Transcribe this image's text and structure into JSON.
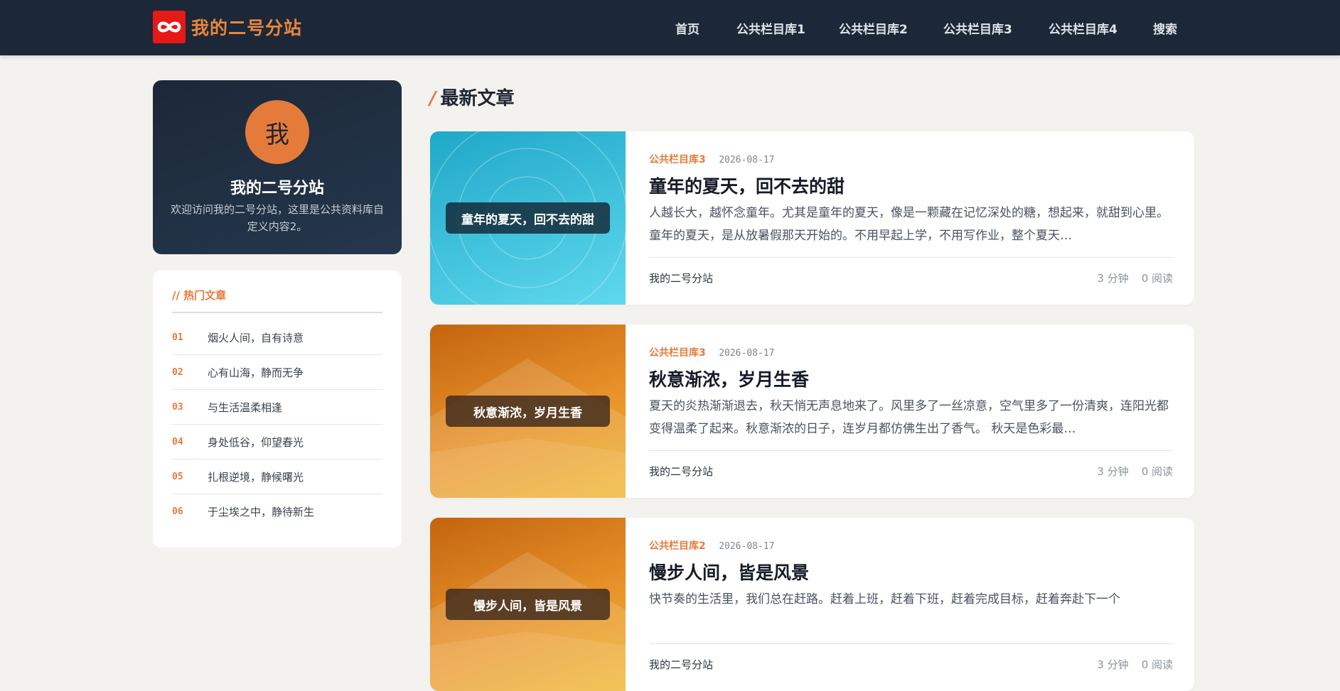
{
  "header": {
    "site_name": "我的二号分站",
    "logo_icon": "infinity-icon",
    "nav": [
      {
        "label": "首页"
      },
      {
        "label": "公共栏目库1"
      },
      {
        "label": "公共栏目库2"
      },
      {
        "label": "公共栏目库3"
      },
      {
        "label": "公共栏目库4"
      },
      {
        "label": "搜索"
      }
    ]
  },
  "profile": {
    "avatar_char": "我",
    "name": "我的二号分站",
    "desc": "欢迎访问我的二号分站，这里是公共资料库自定义内容2。"
  },
  "hot": {
    "title": "// 热门文章",
    "items": [
      {
        "num": "01",
        "text": "烟火人间，自有诗意"
      },
      {
        "num": "02",
        "text": "心有山海，静而无争"
      },
      {
        "num": "03",
        "text": "与生活温柔相逢"
      },
      {
        "num": "04",
        "text": "身处低谷，仰望春光"
      },
      {
        "num": "05",
        "text": "扎根逆境，静候曙光"
      },
      {
        "num": "06",
        "text": "于尘埃之中，静待新生"
      }
    ]
  },
  "main": {
    "section_title": "最新文章",
    "section_slash": "/",
    "articles": [
      {
        "thumb_label": "童年的夏天，回不去的甜",
        "category": "公共栏目库3",
        "date": "2026-08-17",
        "title": "童年的夏天，回不去的甜",
        "excerpt": "人越长大，越怀念童年。尤其是童年的夏天，像是一颗藏在记忆深处的糖，想起来，就甜到心里。 童年的夏天，是从放暑假那天开始的。不用早起上学，不用写作业，整个夏天…",
        "author": "我的二号分站",
        "read_time": "3 分钟",
        "views": "0 阅读"
      },
      {
        "thumb_label": "秋意渐浓，岁月生香",
        "category": "公共栏目库3",
        "date": "2026-08-17",
        "title": "秋意渐浓，岁月生香",
        "excerpt": "夏天的炎热渐渐退去，秋天悄无声息地来了。风里多了一丝凉意，空气里多了一份清爽，连阳光都变得温柔了起来。秋意渐浓的日子，连岁月都仿佛生出了香气。 秋天是色彩最…",
        "author": "我的二号分站",
        "read_time": "3 分钟",
        "views": "0 阅读"
      },
      {
        "thumb_label": "慢步人间，皆是风景",
        "category": "公共栏目库2",
        "date": "2026-08-17",
        "title": "慢步人间，皆是风景",
        "excerpt": "快节奏的生活里，我们总在赶路。赶着上班，赶着下班，赶着完成目标，赶着奔赴下一个",
        "author": "我的二号分站",
        "read_time": "3 分钟",
        "views": "0 阅读"
      }
    ]
  },
  "colors": {
    "header_bg": "#1c2737",
    "accent": "#e57b3a",
    "logo_red": "#e61919",
    "page_bg": "#f4f2ef"
  }
}
